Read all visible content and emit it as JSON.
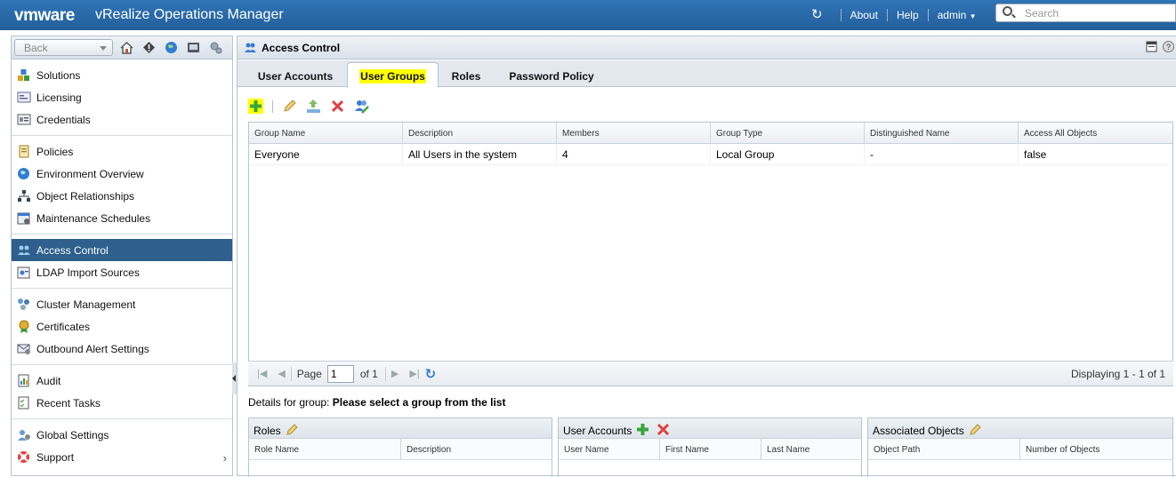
{
  "header": {
    "logo_text": "vmware",
    "app_title": "vRealize Operations Manager",
    "links": [
      "About",
      "Help",
      "admin"
    ],
    "search_placeholder": "Search"
  },
  "left_panel": {
    "back_label": "Back",
    "groups": [
      [
        {
          "label": "Solutions",
          "icon": "solutions-icon"
        },
        {
          "label": "Licensing",
          "icon": "licensing-icon"
        },
        {
          "label": "Credentials",
          "icon": "credentials-icon"
        }
      ],
      [
        {
          "label": "Policies",
          "icon": "policies-icon"
        },
        {
          "label": "Environment Overview",
          "icon": "environment-icon"
        },
        {
          "label": "Object Relationships",
          "icon": "relationships-icon"
        },
        {
          "label": "Maintenance Schedules",
          "icon": "maintenance-icon"
        }
      ],
      [
        {
          "label": "Access Control",
          "icon": "access-control-icon",
          "selected": true
        },
        {
          "label": "LDAP Import Sources",
          "icon": "ldap-icon"
        }
      ],
      [
        {
          "label": "Cluster Management",
          "icon": "cluster-icon"
        },
        {
          "label": "Certificates",
          "icon": "certificate-icon"
        },
        {
          "label": "Outbound Alert Settings",
          "icon": "outbound-alert-icon"
        }
      ],
      [
        {
          "label": "Audit",
          "icon": "audit-icon"
        },
        {
          "label": "Recent Tasks",
          "icon": "tasks-icon"
        }
      ],
      [
        {
          "label": "Global Settings",
          "icon": "global-settings-icon"
        },
        {
          "label": "Support",
          "icon": "support-icon"
        }
      ]
    ]
  },
  "main": {
    "title": "Access Control",
    "tabs": [
      "User Accounts",
      "User Groups",
      "Roles",
      "Password Policy"
    ],
    "active_tab": "User Groups",
    "grid": {
      "columns": [
        "Group Name",
        "Description",
        "Members",
        "Group Type",
        "Distinguished Name",
        "Access All Objects"
      ],
      "rows": [
        [
          "Everyone",
          "All Users in the system",
          "4",
          "Local Group",
          "-",
          "false"
        ]
      ]
    },
    "pager": {
      "page_label": "Page",
      "page_value": "1",
      "of_label": "of 1",
      "displaying": "Displaying 1 - 1 of 1"
    },
    "details_prefix": "Details for group:",
    "details_value": "Please select a group from the list",
    "subpanels": {
      "roles": {
        "title": "Roles",
        "columns": [
          "Role Name",
          "Description"
        ]
      },
      "user_accounts": {
        "title": "User Accounts",
        "columns": [
          "User Name",
          "First Name",
          "Last Name"
        ]
      },
      "associated_objects": {
        "title": "Associated Objects",
        "columns": [
          "Object Path",
          "Number of Objects"
        ]
      }
    }
  },
  "colors": {
    "header_blue": "#2f74b5",
    "selected_nav": "#2e5f8d",
    "highlight": "#ffff00",
    "add_green": "#3aa53a",
    "delete_red": "#e04040"
  }
}
